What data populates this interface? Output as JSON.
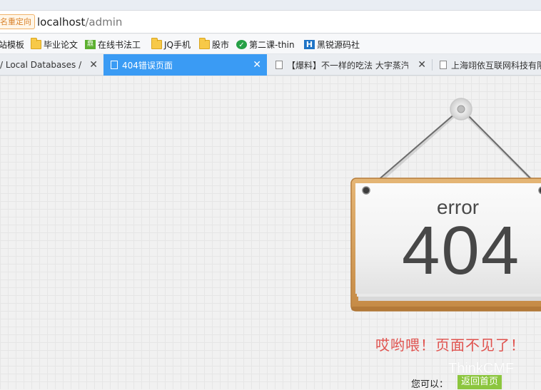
{
  "browser": {
    "redirect_badge": "名重定向",
    "url_host": "localhost",
    "url_path": "/admin"
  },
  "bookmarks": [
    {
      "label": "站模板",
      "icon": "none"
    },
    {
      "label": "毕业论文",
      "icon": "folder-icon"
    },
    {
      "label": "在线书法工",
      "icon": "green-square-icon"
    },
    {
      "label": "JQ手机",
      "icon": "folder-icon"
    },
    {
      "label": "股市",
      "icon": "folder-icon"
    },
    {
      "label": "第二课-thin",
      "icon": "green-circle-icon"
    },
    {
      "label": "黑锐源码社",
      "icon": "blue-h-icon"
    }
  ],
  "tabs": [
    {
      "label": "/ Local Databases /",
      "active": false
    },
    {
      "label": "404错误页面",
      "active": true
    },
    {
      "label": "【爆料】不一样的吃法 大宇蒸汽",
      "active": false
    },
    {
      "label": "上海翊依互联网科技有限",
      "active": false
    }
  ],
  "close_glyph": "✕",
  "page": {
    "error_word": "error",
    "error_code": "404",
    "message": "哎哟喂！页面不见了！",
    "watermark": "ThinkCMF",
    "footer_label": "您可以：",
    "home_button": "返回首页"
  },
  "colors": {
    "active_tab": "#3a9bf4",
    "message": "#e0524e",
    "home_button": "#8cc63f"
  }
}
